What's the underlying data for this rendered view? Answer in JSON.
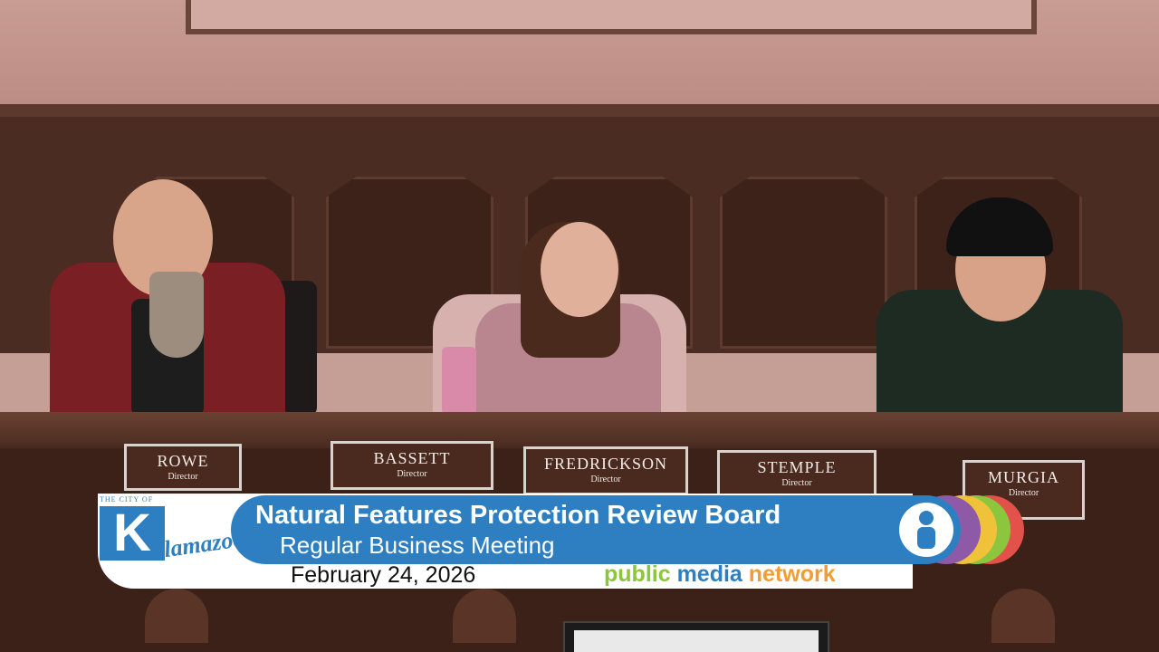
{
  "meeting": {
    "title": "Natural Features Protection Review Board",
    "subtitle": "Regular Business Meeting",
    "date": "February 24, 2026"
  },
  "brand": {
    "city_tag": "THE CITY OF",
    "city_letter": "K",
    "city_word": "alamazoo",
    "network": {
      "word1": "public",
      "word2": "media",
      "word3": "network"
    }
  },
  "nameplates": [
    {
      "name": "ROWE",
      "title": "Director"
    },
    {
      "name": "BASSETT",
      "title": "Director"
    },
    {
      "name": "FREDRICKSON",
      "title": "Director"
    },
    {
      "name": "STEMPLE",
      "title": "Director"
    },
    {
      "name": "MURGIA",
      "title": "Director"
    }
  ],
  "colors": {
    "accent_blue": "#2e7fc1",
    "network_green": "#8cc63f",
    "network_blue": "#2e7fc1",
    "network_orange": "#f39c34",
    "ring_purple": "#8e5aa8",
    "ring_yellow": "#f0c23a",
    "ring_green": "#8cc63f",
    "ring_red": "#e2524a"
  },
  "icons": {
    "logo": "info-person-icon"
  }
}
